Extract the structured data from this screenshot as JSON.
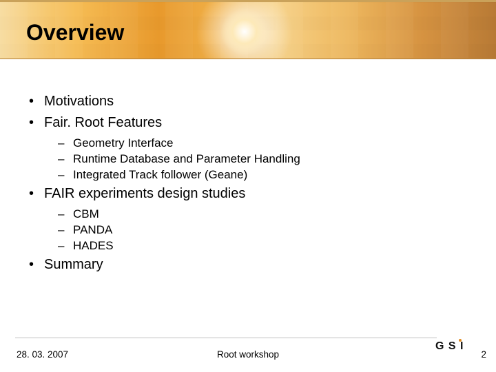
{
  "title": "Overview",
  "bullets": {
    "b0": "Motivations",
    "b1": "Fair. Root Features",
    "b1_sub": {
      "s0": "Geometry Interface",
      "s1": "Runtime Database and Parameter Handling",
      "s2": "Integrated Track follower (Geane)"
    },
    "b2": "FAIR experiments design studies",
    "b2_sub": {
      "s0": "CBM",
      "s1": "PANDA",
      "s2": "HADES"
    },
    "b3": "Summary"
  },
  "footer": {
    "date": "28. 03. 2007",
    "center": "Root workshop",
    "page": "2"
  },
  "logo_text": "GSI"
}
